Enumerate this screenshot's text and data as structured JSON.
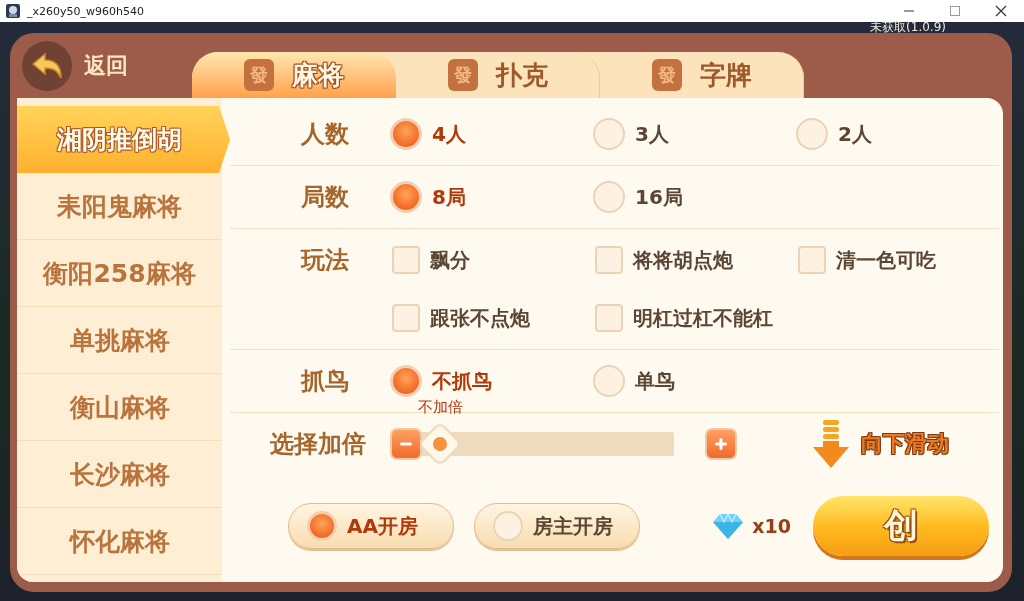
{
  "window": {
    "title": "_x260y50_w960h540"
  },
  "version": "未获取(1.0.9)",
  "back_button": {
    "label": "返回"
  },
  "tabs": [
    {
      "badge": "發",
      "label": "麻将",
      "selected": true
    },
    {
      "badge": "發",
      "label": "扑克",
      "selected": false
    },
    {
      "badge": "發",
      "label": "字牌",
      "selected": false
    }
  ],
  "sidebar": {
    "items": [
      {
        "label": "湘阴推倒胡",
        "selected": true
      },
      {
        "label": "耒阳鬼麻将",
        "selected": false
      },
      {
        "label": "衡阳258麻将",
        "selected": false
      },
      {
        "label": "单挑麻将",
        "selected": false
      },
      {
        "label": "衡山麻将",
        "selected": false
      },
      {
        "label": "长沙麻将",
        "selected": false
      },
      {
        "label": "怀化麻将",
        "selected": false
      }
    ]
  },
  "settings": [
    {
      "label": "人数",
      "kind": "radio",
      "options": [
        {
          "label": "4人",
          "selected": true
        },
        {
          "label": "3人",
          "selected": false
        },
        {
          "label": "2人",
          "selected": false
        }
      ]
    },
    {
      "label": "局数",
      "kind": "radio",
      "options": [
        {
          "label": "8局",
          "selected": true
        },
        {
          "label": "16局",
          "selected": false
        }
      ]
    },
    {
      "label": "玩法",
      "kind": "checkbox",
      "options": [
        {
          "label": "飘分",
          "checked": false
        },
        {
          "label": "将将胡点炮",
          "checked": false
        },
        {
          "label": "清一色可吃",
          "checked": false
        },
        {
          "label": "跟张不点炮",
          "checked": false
        },
        {
          "label": "明杠过杠不能杠",
          "checked": false
        }
      ]
    },
    {
      "label": "抓鸟",
      "kind": "radio",
      "options": [
        {
          "label": "不抓鸟",
          "selected": true
        },
        {
          "label": "单鸟",
          "selected": false
        }
      ]
    }
  ],
  "multiplier": {
    "label": "选择加倍",
    "value": "不加倍"
  },
  "scroll_hint": "向下滑动",
  "payment": [
    {
      "label": "AA开房",
      "selected": true
    },
    {
      "label": "房主开房",
      "selected": false
    }
  ],
  "cost": "x10",
  "create_button": {
    "label": "创"
  }
}
